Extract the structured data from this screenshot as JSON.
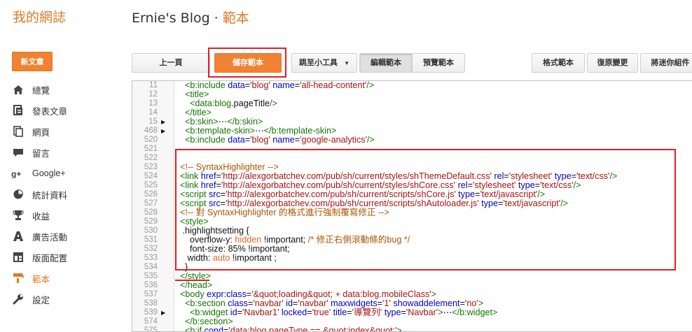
{
  "brand": "我的網誌",
  "header": {
    "blog_name": "Ernie's Blog",
    "separator": "·",
    "section": "範本"
  },
  "sidebar": {
    "new_post": "新文章",
    "items": [
      {
        "label": "總覽",
        "icon": "home-icon"
      },
      {
        "label": "發表文章",
        "icon": "posts-icon"
      },
      {
        "label": "網頁",
        "icon": "pages-icon"
      },
      {
        "label": "留言",
        "icon": "comments-icon"
      },
      {
        "label": "Google+",
        "icon": "google-plus-icon"
      },
      {
        "label": "統計資料",
        "icon": "stats-icon"
      },
      {
        "label": "收益",
        "icon": "earnings-icon"
      },
      {
        "label": "廣告活動",
        "icon": "campaigns-icon"
      },
      {
        "label": "版面配置",
        "icon": "layout-icon"
      },
      {
        "label": "範本",
        "icon": "template-icon",
        "active": true
      },
      {
        "label": "設定",
        "icon": "settings-icon"
      }
    ]
  },
  "toolbar": {
    "back": "上一頁",
    "save": "儲存範本",
    "jump": "跳至小工具",
    "edit": "編輯範本",
    "preview": "預覽範本",
    "format": "格式範本",
    "revert": "復原變更",
    "expand": "將迷你組件"
  },
  "accent_color": "#dd7a29",
  "highlight_color": "#e01f26",
  "code_lines": [
    {
      "n": "11",
      "text": "  <b:include data='blog' name='all-head-content'/>"
    },
    {
      "n": "12",
      "text": "  <title>"
    },
    {
      "n": "13",
      "text": "    <data:blog.pageTitle/>"
    },
    {
      "n": "14",
      "text": "  </title>"
    },
    {
      "n": "15",
      "text": "  <b:skin>⋯</b:skin>",
      "fold": true
    },
    {
      "n": "468",
      "text": "  <b:template-skin>⋯</b:template-skin>",
      "fold": true
    },
    {
      "n": "520",
      "text": "  <b:include data='blog' name='google-analytics'/>"
    },
    {
      "n": "521",
      "text": ""
    },
    {
      "n": "522",
      "text": ""
    },
    {
      "n": "523",
      "text": "<!-- SyntaxHighlighter -->"
    },
    {
      "n": "524",
      "text": "<link href='http://alexgorbatchev.com/pub/sh/current/styles/shThemeDefault.css' rel='stylesheet' type='text/css'/>"
    },
    {
      "n": "525",
      "text": "<link href='http://alexgorbatchev.com/pub/sh/current/styles/shCore.css' rel='stylesheet' type='text/css'/>"
    },
    {
      "n": "526",
      "text": "<script src='http://alexgorbatchev.com/pub/sh/current/scripts/shCore.js' type='text/javascript'/>"
    },
    {
      "n": "527",
      "text": "<script src='http://alexgorbatchev.com/pub/sh/current/scripts/shAutoloader.js' type='text/javascript'/>"
    },
    {
      "n": "528",
      "text": "<!-- 對 SyntaxHighlighter 的格式進行強制覆寫修正 -->"
    },
    {
      "n": "529",
      "text": "<style>"
    },
    {
      "n": "530",
      "text": " .highlightsetting {"
    },
    {
      "n": "531",
      "text": "    overflow-y: hidden !important; /* 修正右側滾動條的bug */"
    },
    {
      "n": "532",
      "text": "    font-size: 85% !important;"
    },
    {
      "n": "533",
      "text": "   width: auto !important ;"
    },
    {
      "n": "534",
      "text": "  }"
    },
    {
      "n": "535",
      "text": "</style>"
    },
    {
      "n": "536",
      "text": "</head>"
    },
    {
      "n": "537",
      "text": "<body expr:class='&quot;loading&quot; + data:blog.mobileClass'>"
    },
    {
      "n": "538",
      "text": "  <b:section class='navbar' id='navbar' maxwidgets='1' showaddelement='no'>"
    },
    {
      "n": "539",
      "text": "    <b:widget id='Navbar1' locked='true' title='導覽列' type='Navbar'>⋯</b:widget>",
      "fold": true
    },
    {
      "n": "574",
      "text": "  </b:section>"
    },
    {
      "n": "575",
      "text": "  <b:if cond='data:blog.pageType == &quot;index&quot;'>"
    }
  ]
}
